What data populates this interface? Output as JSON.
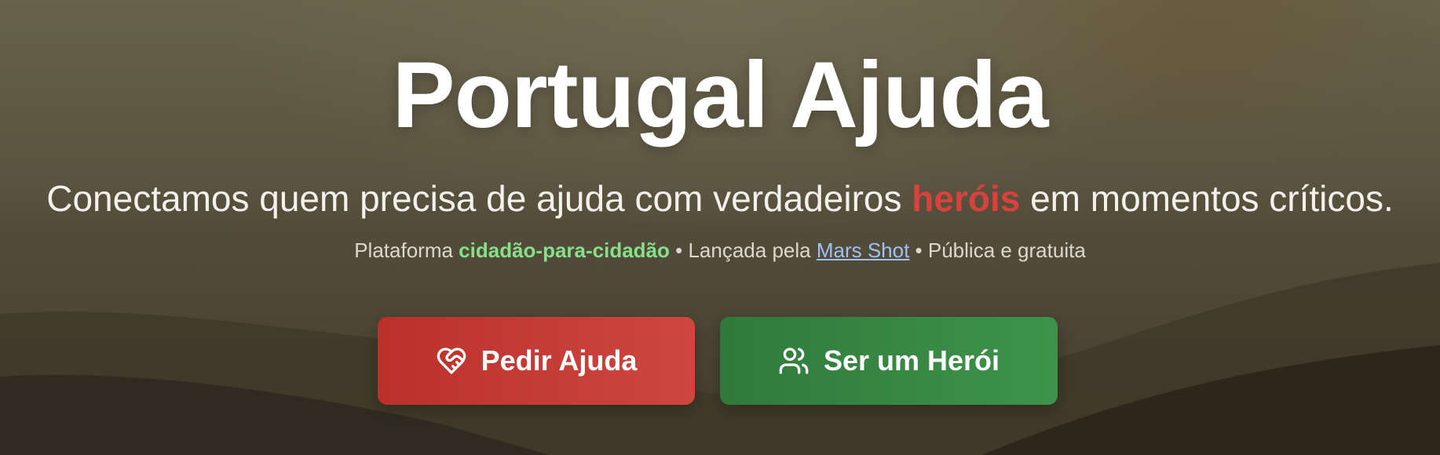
{
  "hero": {
    "title": "Portugal Ajuda",
    "subtitle_before": "Conectamos quem precisa de ajuda com verdadeiros ",
    "subtitle_highlight": "heróis",
    "subtitle_after": " em momentos críticos.",
    "meta_platform": "Plataforma ",
    "meta_platform_highlight": "cidadão-para-cidadão",
    "meta_sep1": " • Lançada pela ",
    "meta_link": "Mars Shot",
    "meta_sep2": " • Pública e gratuita"
  },
  "buttons": {
    "help_label": "Pedir Ajuda",
    "help_icon": "heart-handshake-icon",
    "hero_label": "Ser um Herói",
    "hero_icon": "users-icon"
  },
  "colors": {
    "accent_red": "#c6392f",
    "accent_green": "#378a44",
    "highlight_green": "#86e08a",
    "link_blue": "#9ec2f3"
  }
}
